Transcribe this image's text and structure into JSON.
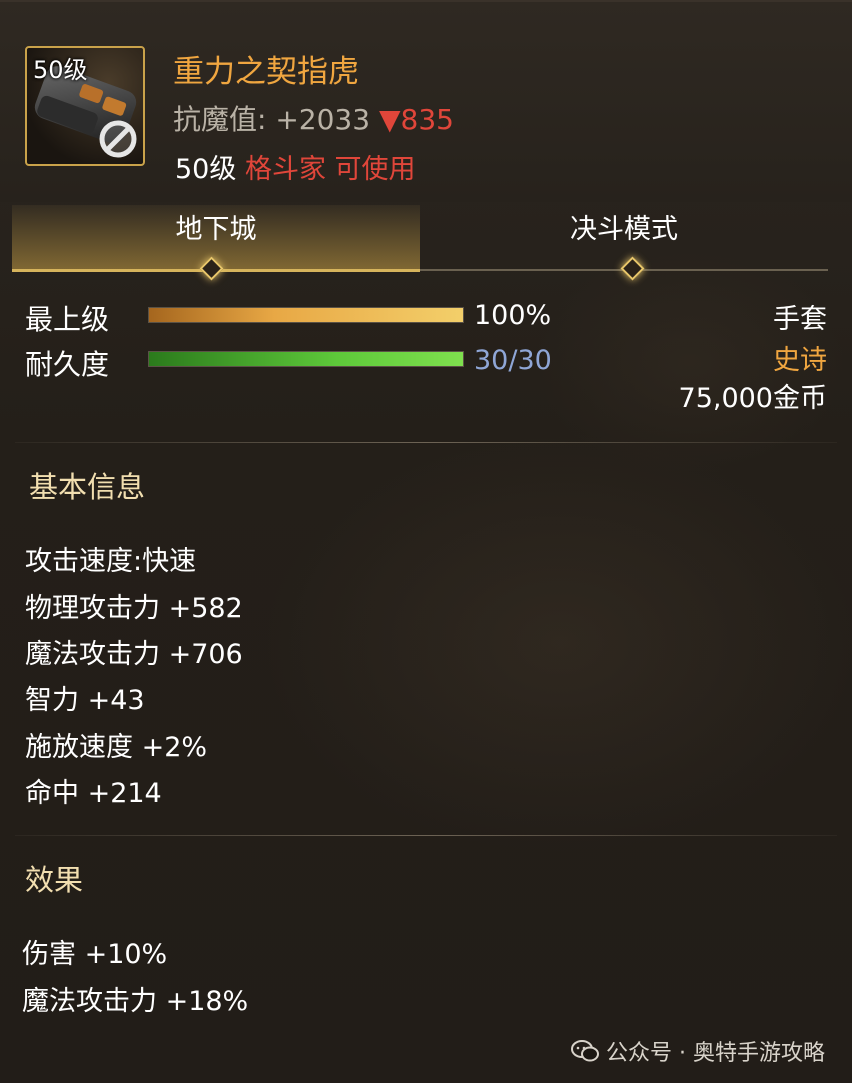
{
  "item": {
    "icon_level": "50级",
    "name": "重力之契指虎",
    "stat_label": "抗魔值:",
    "stat_value": "+2033",
    "stat_change": "▼835",
    "req_level": "50级",
    "req_class": "格斗家 可使用",
    "icon": "knuckle-weapon-icon",
    "unusable_icon": "prohibited-icon"
  },
  "tabs": [
    {
      "label": "地下城",
      "active": true
    },
    {
      "label": "决斗模式",
      "active": false
    }
  ],
  "bars": {
    "grade": {
      "label": "最上级",
      "value_text": "100%",
      "fraction": 1.0
    },
    "durability": {
      "label": "耐久度",
      "value_text": "30/30",
      "fraction": 1.0
    }
  },
  "info": {
    "type": "手套",
    "rarity": "史诗",
    "price": "75,000金币"
  },
  "basic": {
    "title": "基本信息",
    "items": [
      "攻击速度:快速",
      "物理攻击力 +582",
      "魔法攻击力 +706",
      "智力 +43",
      "施放速度 +2%",
      "命中 +214"
    ]
  },
  "effects": {
    "title": "效果",
    "items": [
      "伤害 +10%",
      "魔法攻击力 +18%"
    ]
  },
  "watermark": {
    "text": "公众号 · 奥特手游攻略",
    "icon": "wechat-icon"
  },
  "colors": {
    "title": "#f0a640",
    "red": "#e0463a",
    "epic": "#f0a640",
    "durability_text": "#8fa6d6",
    "gold_bar": "#e8a845",
    "green_bar": "#5ec93a"
  }
}
